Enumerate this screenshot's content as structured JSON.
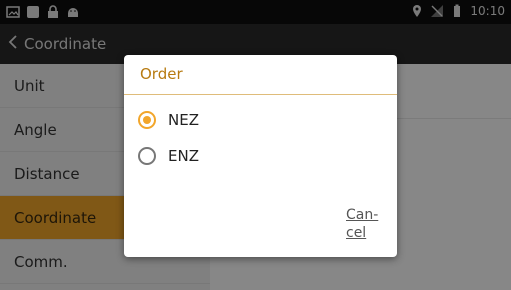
{
  "status_bar": {
    "left_icons": [
      "image-icon",
      "square-icon",
      "lock-icon",
      "android-icon"
    ],
    "right_icons": [
      "location-icon",
      "no-signal-icon",
      "battery-icon"
    ],
    "time": "10:10"
  },
  "action_bar": {
    "back_label": "Coordinate",
    "back_icon": "chevron-left-icon"
  },
  "sidebar": {
    "items": [
      {
        "label": "Unit",
        "active": false
      },
      {
        "label": "Angle",
        "active": false
      },
      {
        "label": "Distance",
        "active": false
      },
      {
        "label": "Coordinate",
        "active": true
      },
      {
        "label": "Comm.",
        "active": false
      }
    ]
  },
  "dialog": {
    "title": "Order",
    "options": [
      {
        "label": "NEZ",
        "selected": true
      },
      {
        "label": "ENZ",
        "selected": false
      }
    ],
    "cancel_line1": "Can-",
    "cancel_line2": "cel"
  },
  "colors": {
    "accent": "#f2a62b",
    "title": "#b77a10",
    "status_bar": "#0f0f0f",
    "action_bar": "#2a2a2a"
  }
}
